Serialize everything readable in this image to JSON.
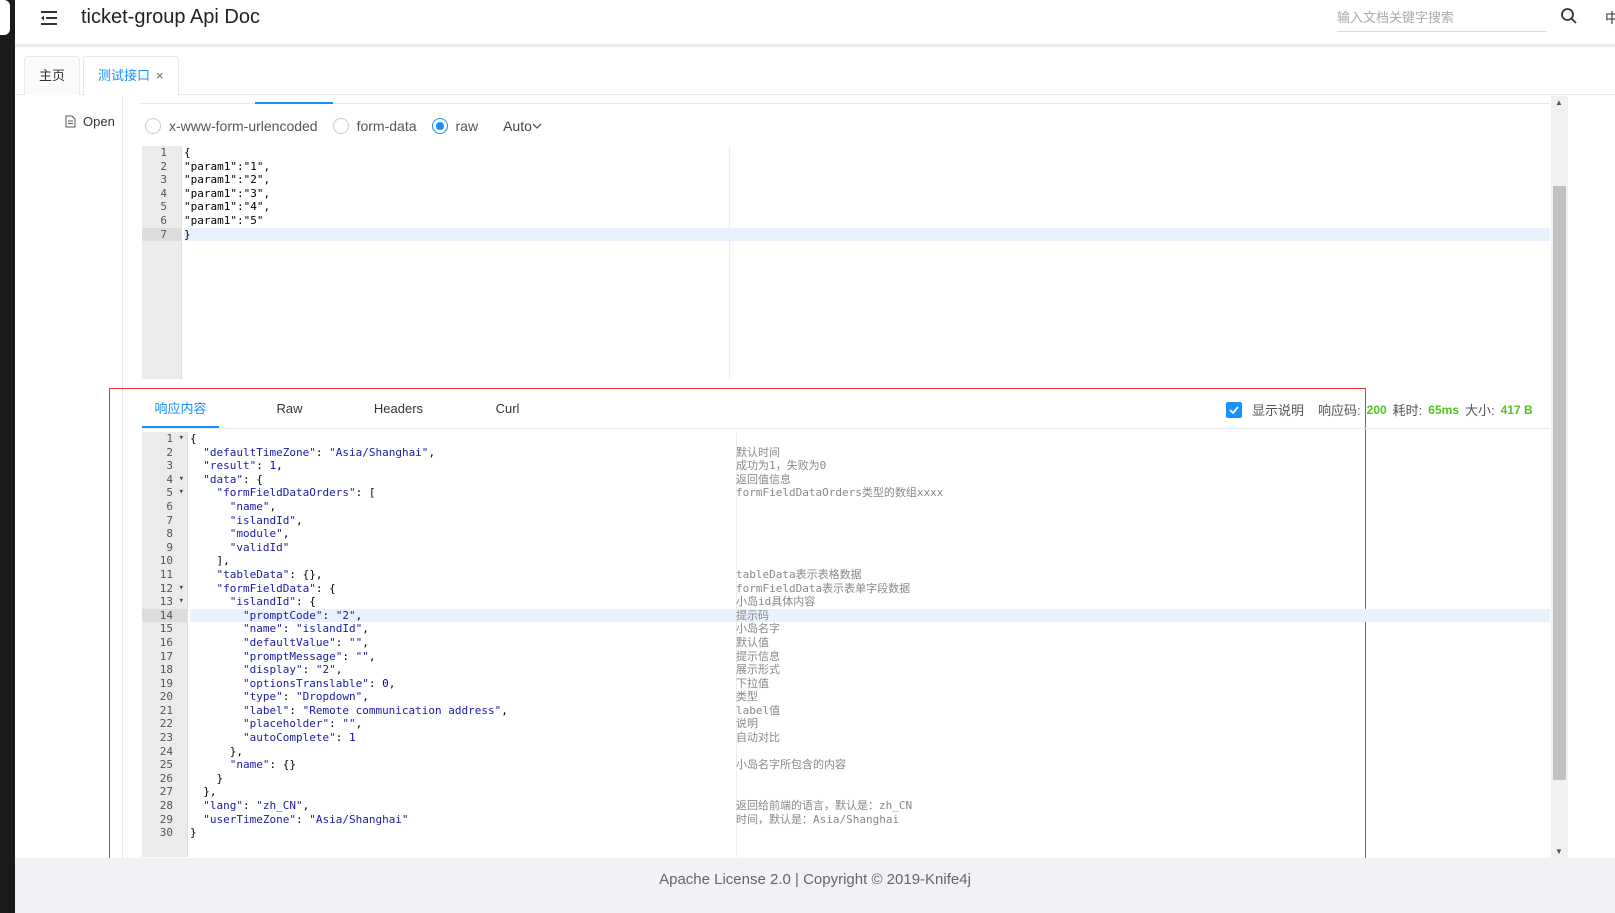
{
  "header": {
    "title": "ticket-group Api Doc",
    "search_placeholder": "输入文档关键字搜索",
    "lang": "中"
  },
  "tabs": [
    {
      "label": "主页",
      "active": false
    },
    {
      "label": "测试接口",
      "active": true,
      "close": "×"
    }
  ],
  "sidebar": {
    "open_label": "Open"
  },
  "request": {
    "body_types": [
      {
        "label": "x-www-form-urlencoded",
        "checked": false
      },
      {
        "label": "form-data",
        "checked": false
      },
      {
        "label": "raw",
        "checked": true
      }
    ],
    "format_select": "Auto",
    "lines": [
      "{",
      "\"param1\":\"1\",",
      "\"param1\":\"2\",",
      "\"param1\":\"3\",",
      "\"param1\":\"4\",",
      "\"param1\":\"5\"",
      "}"
    ],
    "active_line": 7
  },
  "response": {
    "tabs": [
      "响应内容",
      "Raw",
      "Headers",
      "Curl"
    ],
    "active_tab": 0,
    "show_desc_label": "显示说明",
    "status_label": "响应码:",
    "status_value": "200",
    "time_label": "耗时:",
    "time_value": "65ms",
    "size_label": "大小:",
    "size_value": "417 B",
    "active_line": 14,
    "fold_lines": [
      1,
      4,
      5,
      12,
      13
    ],
    "lines": [
      "{",
      "  \"defaultTimeZone\": \"Asia/Shanghai\",",
      "  \"result\": 1,",
      "  \"data\": {",
      "    \"formFieldDataOrders\": [",
      "      \"name\",",
      "      \"islandId\",",
      "      \"module\",",
      "      \"validId\"",
      "    ],",
      "    \"tableData\": {},",
      "    \"formFieldData\": {",
      "      \"islandId\": {",
      "        \"promptCode\": \"2\",",
      "        \"name\": \"islandId\",",
      "        \"defaultValue\": \"\",",
      "        \"promptMessage\": \"\",",
      "        \"display\": \"2\",",
      "        \"optionsTranslable\": 0,",
      "        \"type\": \"Dropdown\",",
      "        \"label\": \"Remote communication address\",",
      "        \"placeholder\": \"\",",
      "        \"autoComplete\": 1",
      "      },",
      "      \"name\": {}",
      "    }",
      "  },",
      "  \"lang\": \"zh_CN\",",
      "  \"userTimeZone\": \"Asia/Shanghai\"",
      "}"
    ],
    "comments": [
      "",
      "默认时间",
      "成功为1，失败为0",
      "返回值信息",
      "formFieldDataOrders类型的数组xxxx",
      "",
      "",
      "",
      "",
      "",
      "tableData表示表格数据",
      "formFieldData表示表单字段数据",
      "小岛id具体内容",
      "提示码",
      "小岛名字",
      "默认值",
      "提示信息",
      "展示形式",
      "下拉值",
      "类型",
      "label值",
      "说明",
      "自动对比",
      "",
      "小岛名字所包含的内容",
      "",
      "",
      "返回给前端的语言，默认是：zh_CN",
      "时间，默认是：Asia/Shanghai",
      ""
    ]
  },
  "footer": {
    "text": "Apache License 2.0 | Copyright © 2019-Knife4j"
  },
  "colors": {
    "accent": "#1890ff",
    "success": "#52c41a",
    "highlight_border": "#e53935"
  }
}
